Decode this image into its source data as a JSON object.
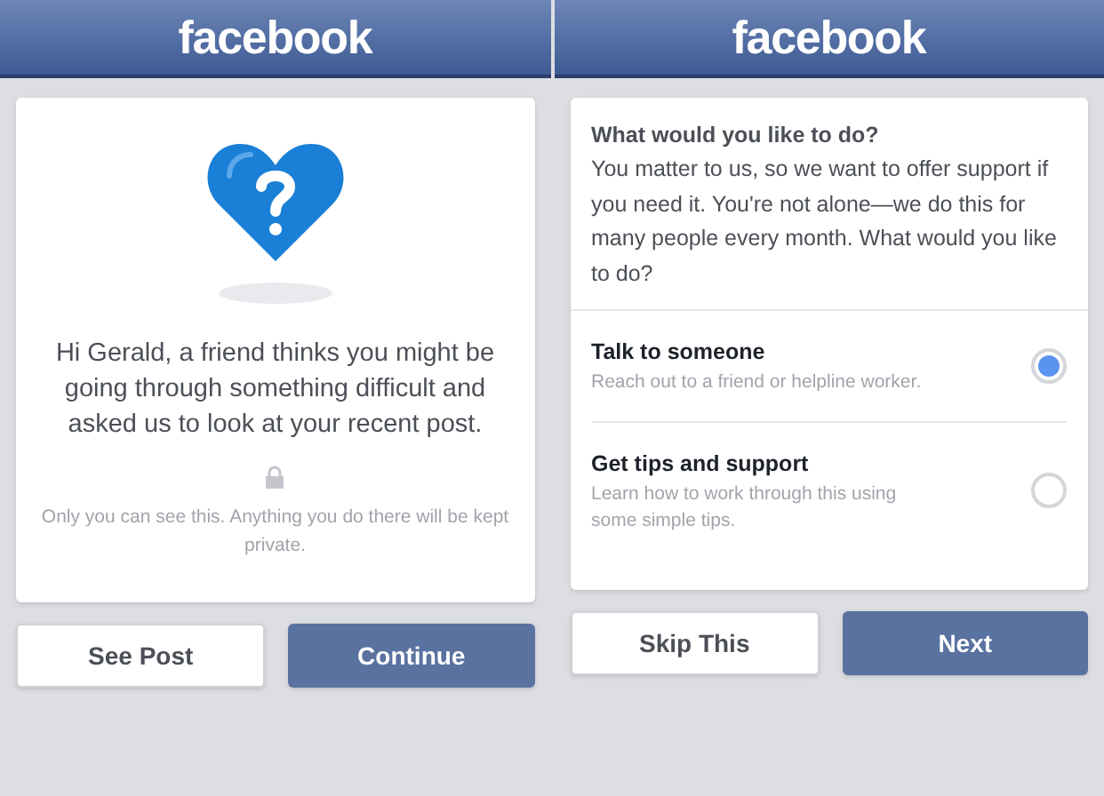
{
  "screens": [
    {
      "kind": "intro",
      "header": {
        "logo": "facebook"
      },
      "card": {
        "message": "Hi Gerald, a friend thinks you might be going through something difficult and asked us to look at your recent post.",
        "privacy_note": "Only you can see this. Anything you do there will be kept private."
      },
      "buttons": [
        {
          "label": "See Post",
          "kind": "secondary"
        },
        {
          "label": "Continue",
          "kind": "primary"
        }
      ]
    },
    {
      "kind": "choice",
      "header": {
        "logo": "facebook"
      },
      "card": {
        "title": "What would you like to do?",
        "body": "You matter to us, so we want to offer support if you need it. You're not alone—we do this for many people every month. What would you like to do?",
        "options": [
          {
            "title": "Talk to someone",
            "description": "Reach out to a friend or helpline worker.",
            "selected": true
          },
          {
            "title": "Get tips and support",
            "description": "Learn how to work through this using some simple tips.",
            "selected": false
          }
        ]
      },
      "buttons": [
        {
          "label": "Skip This",
          "kind": "secondary"
        },
        {
          "label": "Next",
          "kind": "primary"
        }
      ]
    }
  ]
}
